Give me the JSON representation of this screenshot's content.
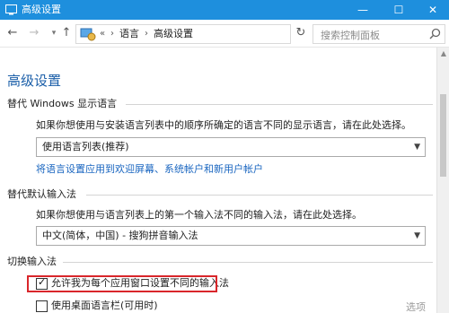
{
  "window": {
    "title": "高级设置"
  },
  "address": {
    "recent_glyph": "«",
    "crumbs": [
      "语言",
      "高级设置"
    ],
    "separator": "›"
  },
  "search": {
    "placeholder": "搜索控制面板"
  },
  "page": {
    "title": "高级设置"
  },
  "display_language": {
    "heading": "替代 Windows 显示语言",
    "description": "如果你想使用与安装语言列表中的顺序所确定的语言不同的显示语言，请在此处选择。",
    "selected": "使用语言列表(推荐)",
    "link": "将语言设置应用到欢迎屏幕、系统帐户和新用户帐户"
  },
  "input_method": {
    "heading": "替代默认输入法",
    "description": "如果你想使用与语言列表上的第一个输入法不同的输入法，请在此处选择。",
    "selected": "中文(简体，中国) - 搜狗拼音输入法"
  },
  "switching": {
    "heading": "切换输入法",
    "options": [
      {
        "label": "允许我为每个应用窗口设置不同的输入法",
        "checked": true
      },
      {
        "label": "使用桌面语言栏(可用时)",
        "checked": false
      }
    ],
    "options_link": "选项"
  },
  "colors": {
    "titlebar": "#1e8fdd",
    "heading_blue": "#1a5ea8",
    "link_blue": "#1a66c0",
    "highlight_red": "#d9262b"
  }
}
